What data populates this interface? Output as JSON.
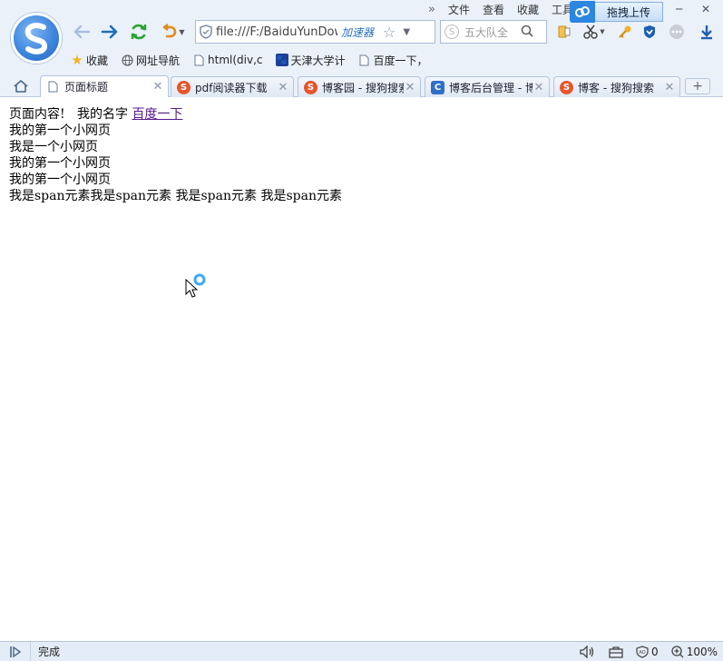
{
  "menu": {
    "overflow": "»",
    "items": [
      "文件",
      "查看",
      "收藏",
      "工具"
    ]
  },
  "upload": {
    "label": "拖拽上传"
  },
  "window": {
    "minimize": "─",
    "maximize": "□",
    "close": "✕"
  },
  "address": {
    "url": "file:///F:/BaiduYunDownload",
    "accelerator": "加速器"
  },
  "search": {
    "placeholder": "五大队全"
  },
  "bookmarks": [
    {
      "label": "收藏",
      "icon": "star-icon"
    },
    {
      "label": "网址导航",
      "icon": "globe-icon"
    },
    {
      "label": "html(div,c",
      "icon": "page-icon"
    },
    {
      "label": "天津大学计",
      "icon": "paw-icon"
    },
    {
      "label": "百度一下，",
      "icon": "page-icon"
    }
  ],
  "tabs": [
    {
      "label": "页面标题",
      "icon": "page-icon",
      "active": true
    },
    {
      "label": "pdf阅读器下载",
      "icon": "sogou-icon"
    },
    {
      "label": "博客园 - 搜狗搜索",
      "icon": "sogou-icon"
    },
    {
      "label": "博客后台管理 - 博客园",
      "icon": "blue-c-icon"
    },
    {
      "label": "博客 - 搜狗搜索",
      "icon": "sogou-icon"
    }
  ],
  "new_tab": "+",
  "page": {
    "line1_text": "页面内容!   我的名字 ",
    "line1_link": "百度一下",
    "lines": [
      "我的第一个小网页",
      "我是一个小网页",
      "我的第一个小网页",
      "我的第一个小网页"
    ],
    "spans": [
      "我是span元素",
      "我是span元素",
      " 我是span元素",
      " 我是span元素"
    ]
  },
  "status": {
    "text": "完成",
    "adblock_count": "0",
    "zoom": "100%"
  }
}
